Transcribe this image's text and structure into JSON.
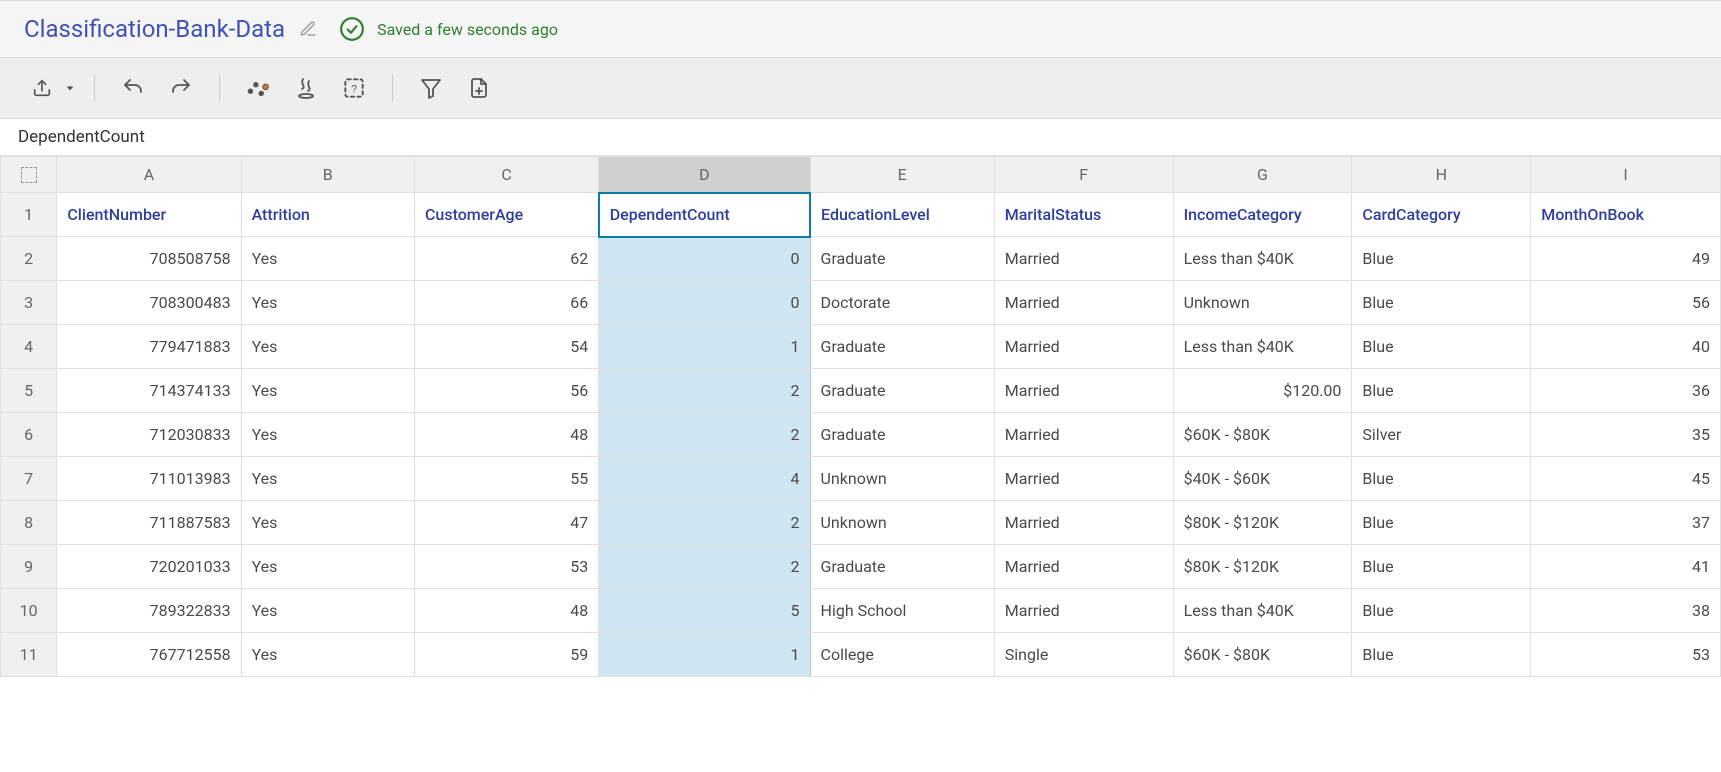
{
  "header": {
    "title": "Classification-Bank-Data",
    "save_status": "Saved a few seconds ago"
  },
  "toolbar": {
    "export_tip": "Export",
    "undo_tip": "Undo",
    "redo_tip": "Redo",
    "profile_tip": "Profile",
    "steps_tip": "Steps",
    "detect_tip": "Detect",
    "filter_tip": "Filter",
    "addcol_tip": "Add column"
  },
  "name_box": "DependentCount",
  "columns": [
    {
      "letter": "A",
      "header": "ClientNumber",
      "field": "ClientNumber",
      "numeric": true,
      "class": "c-A"
    },
    {
      "letter": "B",
      "header": "Attrition",
      "field": "Attrition",
      "numeric": false,
      "class": "c-B"
    },
    {
      "letter": "C",
      "header": "CustomerAge",
      "field": "CustomerAge",
      "numeric": true,
      "class": "c-C"
    },
    {
      "letter": "D",
      "header": "DependentCount",
      "field": "DependentCount",
      "numeric": true,
      "class": "c-D",
      "selected": true
    },
    {
      "letter": "E",
      "header": "EducationLevel",
      "field": "EducationLevel",
      "numeric": false,
      "class": "c-E"
    },
    {
      "letter": "F",
      "header": "MaritalStatus",
      "field": "MaritalStatus",
      "numeric": false,
      "class": "c-F"
    },
    {
      "letter": "G",
      "header": "IncomeCategory",
      "field": "IncomeCategory",
      "numeric": false,
      "class": "c-G"
    },
    {
      "letter": "H",
      "header": "CardCategory",
      "field": "CardCategory",
      "numeric": false,
      "class": "c-H"
    },
    {
      "letter": "I",
      "header": "MonthOnBook",
      "field": "MonthOnBook",
      "numeric": true,
      "class": "c-I"
    }
  ],
  "rows": [
    {
      "ClientNumber": "708508758",
      "Attrition": "Yes",
      "CustomerAge": "62",
      "DependentCount": "0",
      "EducationLevel": "Graduate",
      "MaritalStatus": "Married",
      "IncomeCategory": "Less than $40K",
      "CardCategory": "Blue",
      "MonthOnBook": "49"
    },
    {
      "ClientNumber": "708300483",
      "Attrition": "Yes",
      "CustomerAge": "66",
      "DependentCount": "0",
      "EducationLevel": "Doctorate",
      "MaritalStatus": "Married",
      "IncomeCategory": "Unknown",
      "CardCategory": "Blue",
      "MonthOnBook": "56"
    },
    {
      "ClientNumber": "779471883",
      "Attrition": "Yes",
      "CustomerAge": "54",
      "DependentCount": "1",
      "EducationLevel": "Graduate",
      "MaritalStatus": "Married",
      "IncomeCategory": "Less than $40K",
      "CardCategory": "Blue",
      "MonthOnBook": "40"
    },
    {
      "ClientNumber": "714374133",
      "Attrition": "Yes",
      "CustomerAge": "56",
      "DependentCount": "2",
      "EducationLevel": "Graduate",
      "MaritalStatus": "Married",
      "IncomeCategory": "$120.00",
      "CardCategory": "Blue",
      "MonthOnBook": "36"
    },
    {
      "ClientNumber": "712030833",
      "Attrition": "Yes",
      "CustomerAge": "48",
      "DependentCount": "2",
      "EducationLevel": "Graduate",
      "MaritalStatus": "Married",
      "IncomeCategory": "$60K - $80K",
      "CardCategory": "Silver",
      "MonthOnBook": "35"
    },
    {
      "ClientNumber": "711013983",
      "Attrition": "Yes",
      "CustomerAge": "55",
      "DependentCount": "4",
      "EducationLevel": "Unknown",
      "MaritalStatus": "Married",
      "IncomeCategory": "$40K - $60K",
      "CardCategory": "Blue",
      "MonthOnBook": "45"
    },
    {
      "ClientNumber": "711887583",
      "Attrition": "Yes",
      "CustomerAge": "47",
      "DependentCount": "2",
      "EducationLevel": "Unknown",
      "MaritalStatus": "Married",
      "IncomeCategory": "$80K - $120K",
      "CardCategory": "Blue",
      "MonthOnBook": "37"
    },
    {
      "ClientNumber": "720201033",
      "Attrition": "Yes",
      "CustomerAge": "53",
      "DependentCount": "2",
      "EducationLevel": "Graduate",
      "MaritalStatus": "Married",
      "IncomeCategory": "$80K - $120K",
      "CardCategory": "Blue",
      "MonthOnBook": "41"
    },
    {
      "ClientNumber": "789322833",
      "Attrition": "Yes",
      "CustomerAge": "48",
      "DependentCount": "5",
      "EducationLevel": "High School",
      "MaritalStatus": "Married",
      "IncomeCategory": "Less than $40K",
      "CardCategory": "Blue",
      "MonthOnBook": "38"
    },
    {
      "ClientNumber": "767712558",
      "Attrition": "Yes",
      "CustomerAge": "59",
      "DependentCount": "1",
      "EducationLevel": "College",
      "MaritalStatus": "Single",
      "IncomeCategory": "$60K - $80K",
      "CardCategory": "Blue",
      "MonthOnBook": "53"
    }
  ],
  "income_numeric_rows": [
    3
  ]
}
